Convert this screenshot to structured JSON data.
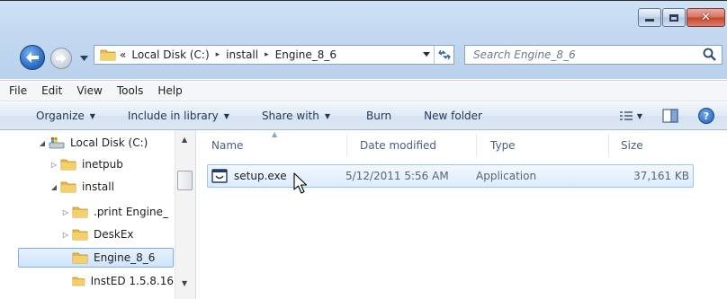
{
  "window": {
    "controls": {
      "minimize_icon": "minimize-icon",
      "maximize_icon": "maximize-icon",
      "close_icon": "close-icon",
      "close_label": "✕"
    }
  },
  "navigation": {
    "back_icon": "back-arrow-icon",
    "forward_icon": "forward-arrow-icon",
    "recent_dropdown_icon": "chevron-down-icon",
    "address": {
      "overflow": "«",
      "crumbs": [
        "Local Disk (C:)",
        "install",
        "Engine_8_6"
      ],
      "separator": "▸"
    },
    "search_placeholder": "Search Engine_8_6"
  },
  "menu": {
    "items": [
      "File",
      "Edit",
      "View",
      "Tools",
      "Help"
    ]
  },
  "commands": {
    "organize": "Organize",
    "include_in_library": "Include in library",
    "share_with": "Share with",
    "burn": "Burn",
    "new_folder": "New folder",
    "dropdown_glyph": "▼",
    "help_glyph": "?"
  },
  "tree": {
    "items": [
      {
        "label": "Local Disk (C:)",
        "icon": "drive-icon",
        "toggle": "◢",
        "selected": false
      },
      {
        "label": "inetpub",
        "icon": "folder-icon",
        "toggle": "▷",
        "selected": false
      },
      {
        "label": "install",
        "icon": "folder-icon",
        "toggle": "◢",
        "selected": false
      },
      {
        "label": ".print Engine_",
        "icon": "folder-icon",
        "toggle": "▷",
        "selected": false
      },
      {
        "label": "DeskEx",
        "icon": "folder-icon",
        "toggle": "▷",
        "selected": false
      },
      {
        "label": "Engine_8_6",
        "icon": "folder-icon",
        "toggle": "",
        "selected": true
      },
      {
        "label": "InstED 1.5.8.16",
        "icon": "folder-icon",
        "toggle": "",
        "selected": false
      }
    ],
    "scroll_up": "▲",
    "scroll_down": "▼"
  },
  "columns": {
    "name": "Name",
    "date_modified": "Date modified",
    "type": "Type",
    "size": "Size",
    "sort_indicator": "▲"
  },
  "files": [
    {
      "name": "setup.exe",
      "date_modified": "5/12/2011 5:56 AM",
      "type": "Application",
      "size": "37,161 KB",
      "icon": "application-icon"
    }
  ],
  "colors": {
    "chrome": "#c3d9f1",
    "selection": "#cfe3fb",
    "selection_border": "#84acdd",
    "folder": "#e8b84a"
  }
}
